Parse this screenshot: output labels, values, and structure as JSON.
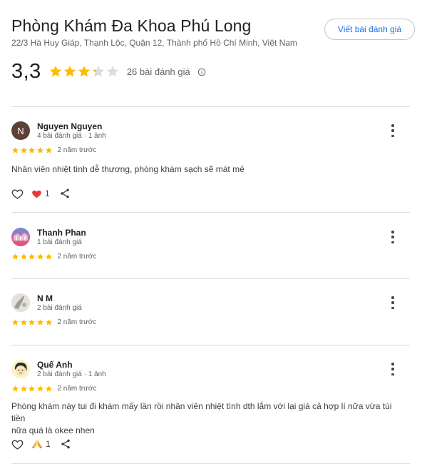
{
  "place": {
    "name": "Phòng Khám Đa Khoa Phú Long",
    "address": "22/3 Hà Huy Giáp, Thạnh Lộc, Quận 12, Thành phố Hồ Chí Minh, Việt Nam",
    "write_review_label": "Viết bài đánh giá"
  },
  "summary": {
    "rating": "3,3",
    "rating_value": 3.3,
    "review_count": "26 bài đánh giá",
    "star_color": "#fbbc04",
    "empty_star_color": "#dadce0"
  },
  "reviews": [
    {
      "author": "Nguyen Nguyen",
      "meta": "4 bài đánh giá · 1 ảnh",
      "avatar_letter": "N",
      "avatar_color": "#5d4037",
      "rating": 5,
      "time": "2 năm trước",
      "text": "Nhân viên nhiệt tình dễ thương, phòng khám sạch sẽ mát mẻ",
      "reaction_icon": "heart-icon",
      "reaction_count": "1"
    },
    {
      "author": "Thanh Phan",
      "meta": "1 bài đánh giá",
      "rating": 5,
      "time": "2 năm trước"
    },
    {
      "author": "N M",
      "meta": "2 bài đánh giá",
      "rating": 5,
      "time": "2 năm trước"
    },
    {
      "author": "Quế Anh",
      "meta": "2 bài đánh giá · 1 ảnh",
      "rating": 5,
      "time": "2 năm trước",
      "text_line1": "Phòng khám này tui đi khám mấy lần rồi nhân viên nhiệt tình dth lắm với lại giá cả hợp lí nữa vừa túi tiền",
      "text_line2": "nữa quá là okee nhen",
      "reaction_icon": "praying-hands-icon",
      "reaction_count": "1"
    }
  ]
}
